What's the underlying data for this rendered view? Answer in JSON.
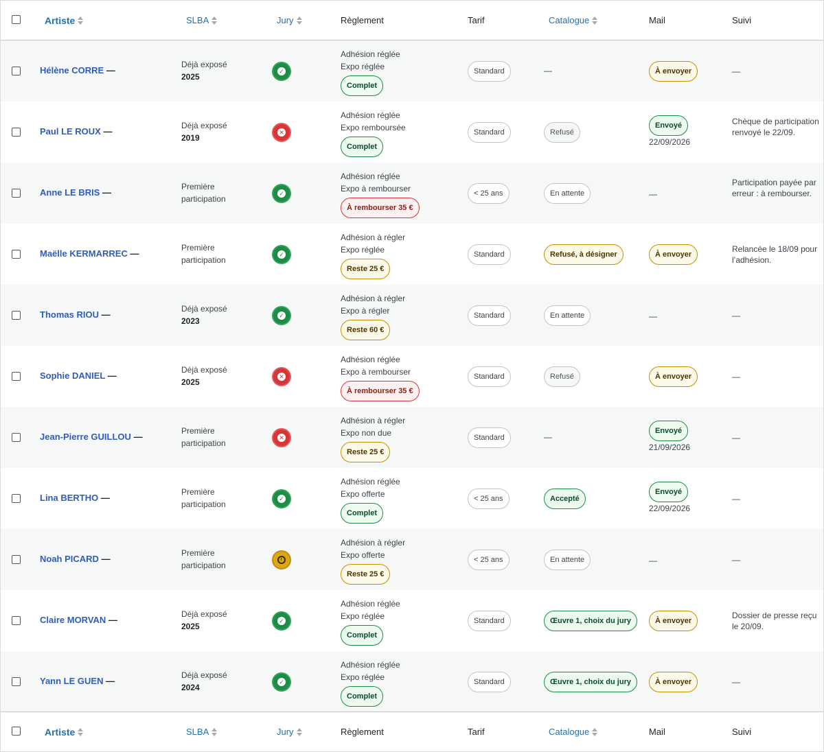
{
  "columns": {
    "artist": "Artiste",
    "slba": "SLBA",
    "jury": "Jury",
    "reglement": "Règlement",
    "tarif": "Tarif",
    "catalogue": "Catalogue",
    "mail": "Mail",
    "suivi": "Suivi"
  },
  "dash": "—",
  "rows": [
    {
      "name": "Hélène CORRE",
      "slba_line1": "Déjà exposé",
      "slba_line2": "2025",
      "slba_bold": true,
      "jury": "ok",
      "reg1": "Adhésion réglée",
      "reg2": "Expo réglée",
      "reg_pill": "Complet",
      "reg_color": "green",
      "tarif": "Standard",
      "catalogue": "—",
      "cat_style": "dash",
      "mail": "À envoyer",
      "mail_style": "yellow",
      "mail_date": "",
      "suivi": "—"
    },
    {
      "name": "Paul LE ROUX",
      "slba_line1": "Déjà exposé",
      "slba_line2": "2019",
      "slba_bold": true,
      "jury": "no",
      "reg1": "Adhésion réglée",
      "reg2": "Expo remboursée",
      "reg_pill": "Complet",
      "reg_color": "green",
      "tarif": "Standard",
      "catalogue": "Refusé",
      "cat_style": "lightgrey",
      "mail": "Envoyé",
      "mail_style": "green",
      "mail_date": "22/09/2026",
      "suivi": "Chèque de participation renvoyé le 22/09."
    },
    {
      "name": "Anne LE BRIS",
      "slba_line1": "Première",
      "slba_line2": "participation",
      "slba_bold": false,
      "jury": "ok",
      "reg1": "Adhésion réglée",
      "reg2": "Expo à rembourser",
      "reg_pill": "À rembourser 35 €",
      "reg_color": "red",
      "tarif": "< 25 ans",
      "catalogue": "En attente",
      "cat_style": "grey",
      "mail": "—",
      "mail_style": "dash",
      "mail_date": "",
      "suivi": "Participation payée par erreur : à rembourser."
    },
    {
      "name": "Maëlle KERMARREC",
      "slba_line1": "Première",
      "slba_line2": "participation",
      "slba_bold": false,
      "jury": "ok",
      "reg1": "Adhésion à régler",
      "reg2": "Expo réglée",
      "reg_pill": "Reste 25 €",
      "reg_color": "yellow",
      "tarif": "Standard",
      "catalogue": "Refusé, à désigner",
      "cat_style": "yellow",
      "mail": "À envoyer",
      "mail_style": "yellow",
      "mail_date": "",
      "suivi": "Relancée le 18/09 pour l’adhésion."
    },
    {
      "name": "Thomas RIOU",
      "slba_line1": "Déjà exposé",
      "slba_line2": "2023",
      "slba_bold": true,
      "jury": "ok",
      "reg1": "Adhésion à régler",
      "reg2": "Expo à régler",
      "reg_pill": "Reste 60 €",
      "reg_color": "yellow",
      "tarif": "Standard",
      "catalogue": "En attente",
      "cat_style": "grey",
      "mail": "—",
      "mail_style": "dash",
      "mail_date": "",
      "suivi": "—"
    },
    {
      "name": "Sophie DANIEL",
      "slba_line1": "Déjà exposé",
      "slba_line2": "2025",
      "slba_bold": true,
      "jury": "no",
      "reg1": "Adhésion réglée",
      "reg2": "Expo à rembourser",
      "reg_pill": "À rembourser 35 €",
      "reg_color": "red",
      "tarif": "Standard",
      "catalogue": "Refusé",
      "cat_style": "lightgrey",
      "mail": "À envoyer",
      "mail_style": "yellow",
      "mail_date": "",
      "suivi": "—"
    },
    {
      "name": "Jean-Pierre GUILLOU",
      "slba_line1": "Première",
      "slba_line2": "participation",
      "slba_bold": false,
      "jury": "no",
      "reg1": "Adhésion à régler",
      "reg2": "Expo non due",
      "reg_pill": "Reste 25 €",
      "reg_color": "yellow",
      "tarif": "Standard",
      "catalogue": "—",
      "cat_style": "dash",
      "mail": "Envoyé",
      "mail_style": "green",
      "mail_date": "21/09/2026",
      "suivi": "—"
    },
    {
      "name": "Lina BERTHO",
      "slba_line1": "Première",
      "slba_line2": "participation",
      "slba_bold": false,
      "jury": "ok",
      "reg1": "Adhésion réglée",
      "reg2": "Expo offerte",
      "reg_pill": "Complet",
      "reg_color": "green",
      "tarif": "< 25 ans",
      "catalogue": "Accepté",
      "cat_style": "green",
      "mail": "Envoyé",
      "mail_style": "green",
      "mail_date": "22/09/2026",
      "suivi": "—"
    },
    {
      "name": "Noah PICARD",
      "slba_line1": "Première",
      "slba_line2": "participation",
      "slba_bold": false,
      "jury": "wait",
      "reg1": "Adhésion à régler",
      "reg2": "Expo offerte",
      "reg_pill": "Reste 25 €",
      "reg_color": "yellow",
      "tarif": "< 25 ans",
      "catalogue": "En attente",
      "cat_style": "grey",
      "mail": "—",
      "mail_style": "dash",
      "mail_date": "",
      "suivi": "—"
    },
    {
      "name": "Claire MORVAN",
      "slba_line1": "Déjà exposé",
      "slba_line2": "2025",
      "slba_bold": true,
      "jury": "ok",
      "reg1": "Adhésion réglée",
      "reg2": "Expo réglée",
      "reg_pill": "Complet",
      "reg_color": "green",
      "tarif": "Standard",
      "catalogue": "Œuvre 1, choix du jury",
      "cat_style": "green",
      "mail": "À envoyer",
      "mail_style": "yellow",
      "mail_date": "",
      "suivi": "Dossier de presse reçu le 20/09."
    },
    {
      "name": "Yann LE GUEN",
      "slba_line1": "Déjà exposé",
      "slba_line2": "2024",
      "slba_bold": true,
      "jury": "ok",
      "reg1": "Adhésion réglée",
      "reg2": "Expo réglée",
      "reg_pill": "Complet",
      "reg_color": "green",
      "tarif": "Standard",
      "catalogue": "Œuvre 1, choix du jury",
      "cat_style": "green",
      "mail": "À envoyer",
      "mail_style": "yellow",
      "mail_date": "",
      "suivi": "—"
    }
  ]
}
